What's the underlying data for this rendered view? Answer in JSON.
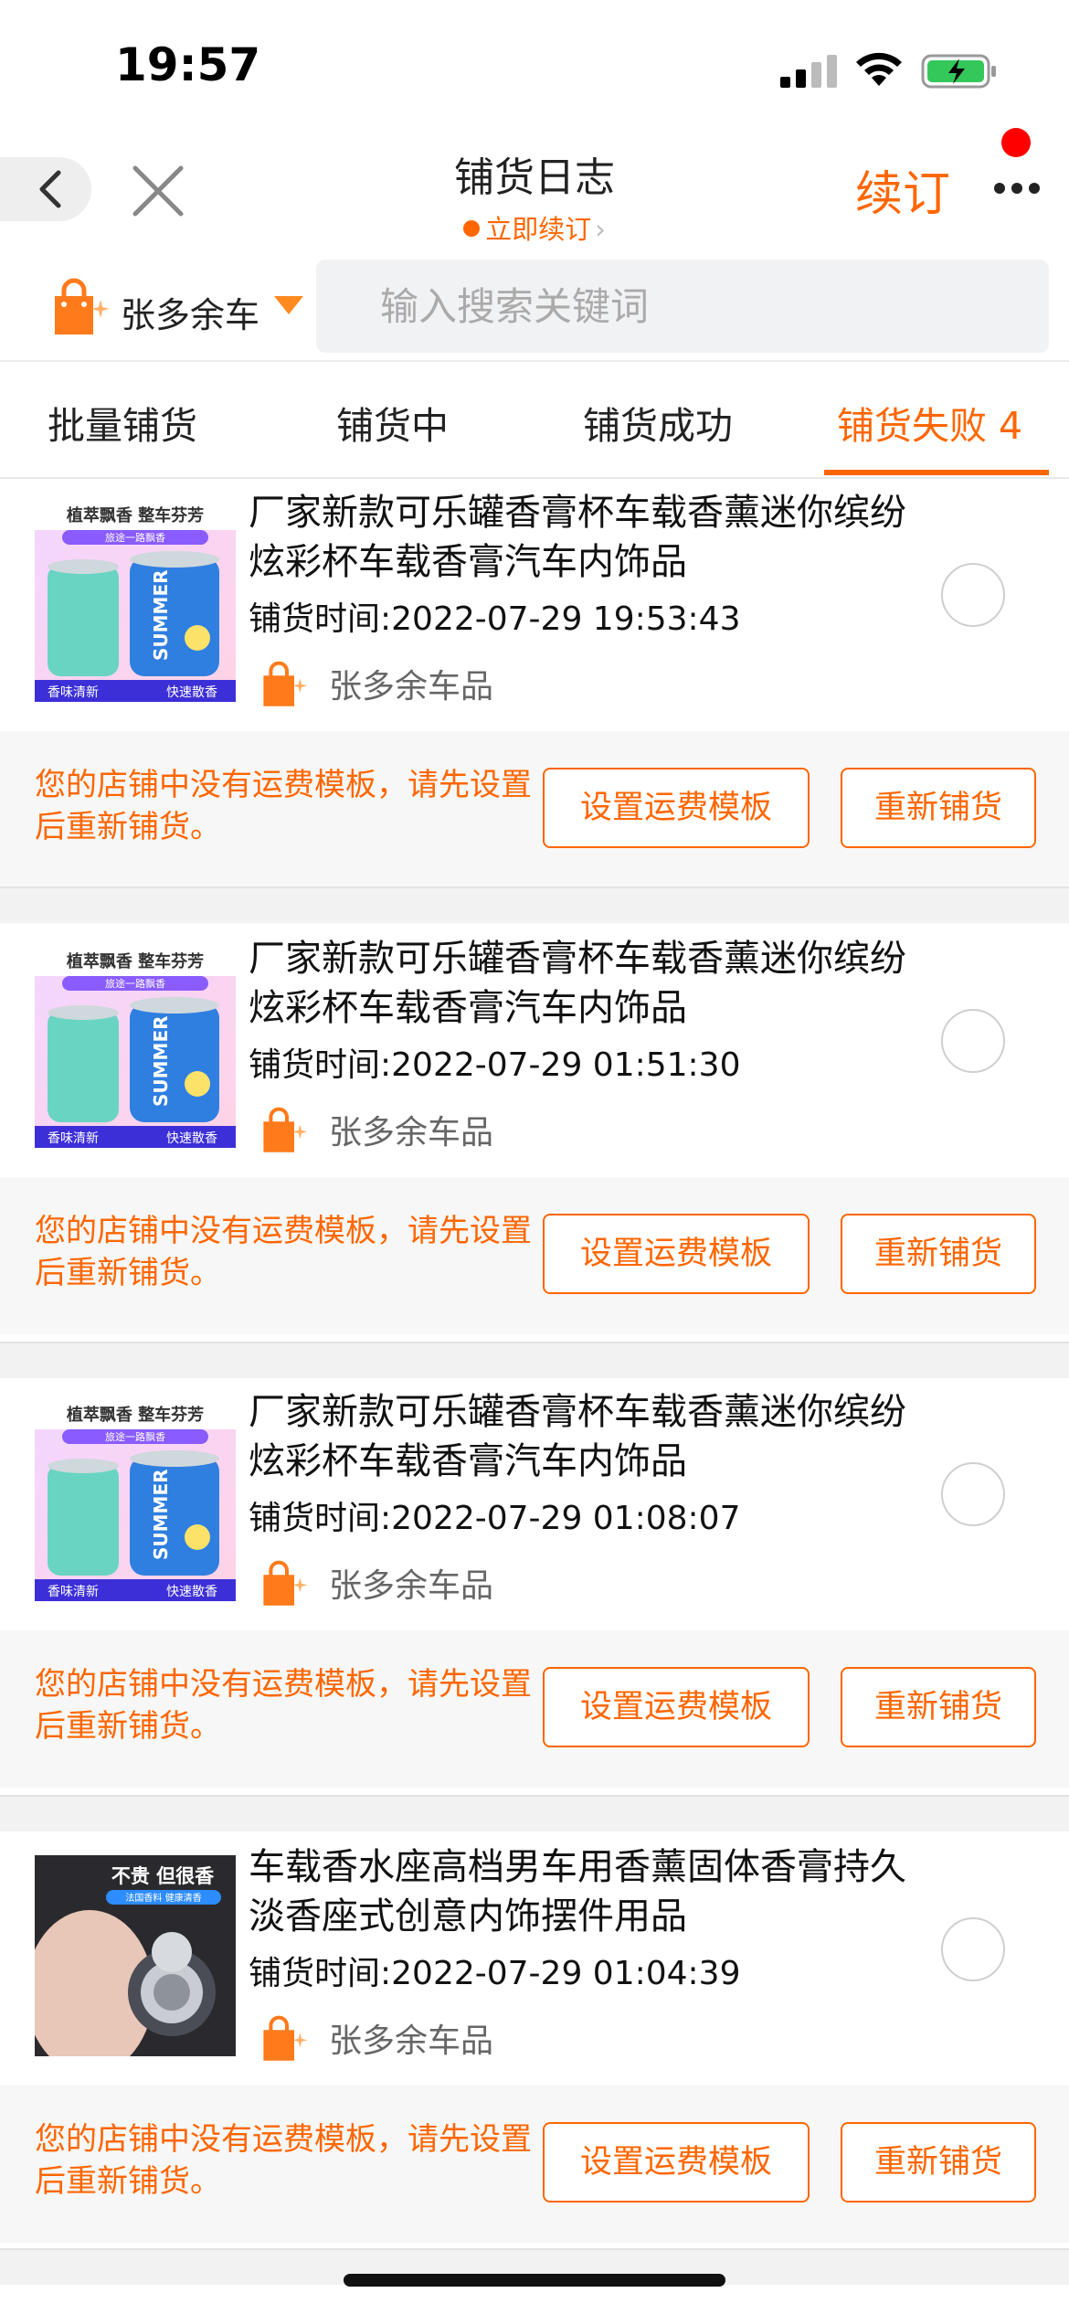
{
  "status_bar": {
    "time": "19:57"
  },
  "header": {
    "title": "铺货日志",
    "renew_link": "立即续订",
    "renew_button": "续订"
  },
  "store": {
    "name": "张多余车"
  },
  "search": {
    "placeholder": "输入搜索关键词",
    "value": ""
  },
  "tabs": [
    {
      "label": "批量铺货",
      "active": false
    },
    {
      "label": "铺货中",
      "active": false
    },
    {
      "label": "铺货成功",
      "active": false
    },
    {
      "label": "铺货失败 4",
      "active": true
    }
  ],
  "items": [
    {
      "title": "厂家新款可乐罐香膏杯车载香薰迷你缤纷炫彩杯车载香膏汽车内饰品",
      "time": "铺货时间:2022-07-29 19:53:43",
      "shop": "张多余车品",
      "thumb": {
        "banner": "植萃飘香 整车芬芳",
        "sub": "旅途一路飘香",
        "can_label": "SUMMER",
        "footer_left": "香味清新",
        "footer_right": "快速散香"
      },
      "notice": "您的店铺中没有运费模板，请先设置后重新铺货。",
      "btn_template": "设置运费模板",
      "btn_relist": "重新铺货"
    },
    {
      "title": "厂家新款可乐罐香膏杯车载香薰迷你缤纷炫彩杯车载香膏汽车内饰品",
      "time": "铺货时间:2022-07-29 01:51:30",
      "shop": "张多余车品",
      "thumb": {
        "banner": "植萃飘香 整车芬芳",
        "sub": "旅途一路飘香",
        "can_label": "SUMMER",
        "footer_left": "香味清新",
        "footer_right": "快速散香"
      },
      "notice": "您的店铺中没有运费模板，请先设置后重新铺货。",
      "btn_template": "设置运费模板",
      "btn_relist": "重新铺货"
    },
    {
      "title": "厂家新款可乐罐香膏杯车载香薰迷你缤纷炫彩杯车载香膏汽车内饰品",
      "time": "铺货时间:2022-07-29 01:08:07",
      "shop": "张多余车品",
      "thumb": {
        "banner": "植萃飘香 整车芬芳",
        "sub": "旅途一路飘香",
        "can_label": "SUMMER",
        "footer_left": "香味清新",
        "footer_right": "快速散香"
      },
      "notice": "您的店铺中没有运费模板，请先设置后重新铺货。",
      "btn_template": "设置运费模板",
      "btn_relist": "重新铺货"
    },
    {
      "title": "车载香水座高档男车用香薰固体香膏持久淡香座式创意内饰摆件用品",
      "time": "铺货时间:2022-07-29 01:04:39",
      "shop": "张多余车品",
      "thumb": {
        "banner": "不贵 但很香",
        "sub": "法国香料 健康清香"
      },
      "notice": "您的店铺中没有运费模板，请先设置后重新铺货。",
      "btn_template": "设置运费模板",
      "btn_relist": "重新铺货"
    }
  ],
  "colors": {
    "accent": "#ff6600",
    "notice_bg": "#f7f7f7",
    "separator": "#f2f2f2"
  }
}
